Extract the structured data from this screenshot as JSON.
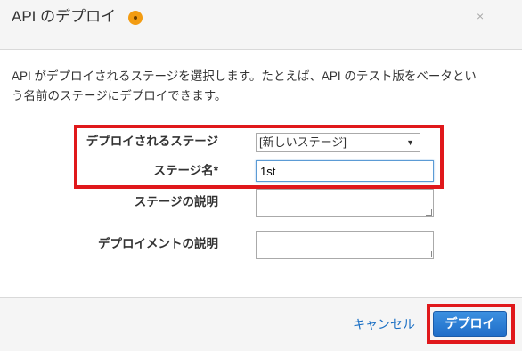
{
  "modal": {
    "title": "API のデプロイ",
    "close_label": "×"
  },
  "description": {
    "line1": "API がデプロイされるステージを選択します。たとえば、API のテスト版をベータとい",
    "line2": "う名前のステージにデプロイできます。"
  },
  "form": {
    "deploy_stage_label": "デプロイされるステージ",
    "deploy_stage_value": "[新しいステージ]",
    "stage_name_label": "ステージ名*",
    "stage_name_value": "1st",
    "stage_desc_label": "ステージの説明",
    "stage_desc_value": "",
    "deployment_desc_label": "デプロイメントの説明",
    "deployment_desc_value": ""
  },
  "footer": {
    "cancel_label": "キャンセル",
    "deploy_label": "デプロイ"
  },
  "colors": {
    "highlight": "#e0181b",
    "primary": "#1f6ec9",
    "info_icon": "#f39c12"
  }
}
